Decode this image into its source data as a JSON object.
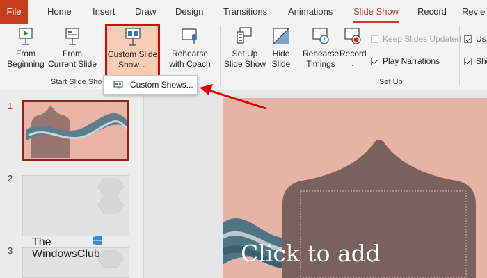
{
  "tabs": {
    "file": "File",
    "home": "Home",
    "insert": "Insert",
    "draw": "Draw",
    "design": "Design",
    "transitions": "Transitions",
    "animations": "Animations",
    "slide_show": "Slide Show",
    "record": "Record",
    "review": "Revie"
  },
  "ribbon": {
    "from_beginning": [
      "From",
      "Beginning"
    ],
    "from_current": [
      "From",
      "Current Slide"
    ],
    "custom_slide_show": [
      "Custom Slide",
      "Show"
    ],
    "rehearse_coach": [
      "Rehearse",
      "with Coach"
    ],
    "set_up_show": [
      "Set Up",
      "Slide Show"
    ],
    "hide_slide": [
      "Hide",
      "Slide"
    ],
    "rehearse_timings": [
      "Rehearse",
      "Timings"
    ],
    "record": "Record",
    "group_start": "Start Slide Sho",
    "group_setup": "Set Up",
    "keep_slides_updated": "Keep Slides Updated",
    "play_narrations": "Play Narrations",
    "use_cut": "Us",
    "show_cut": "Sho"
  },
  "dropdown": {
    "custom_shows": "Custom Shows..."
  },
  "thumbs": {
    "n1": "1",
    "n2": "2",
    "n3": "3"
  },
  "watermark": [
    "The",
    "WindowsClub"
  ],
  "slide": {
    "placeholder": "Click to add"
  },
  "colors": {
    "accent": "#b7472a",
    "file_tab": "#c43e1c",
    "highlight_border": "#e00000",
    "arrow": "#e00000"
  }
}
